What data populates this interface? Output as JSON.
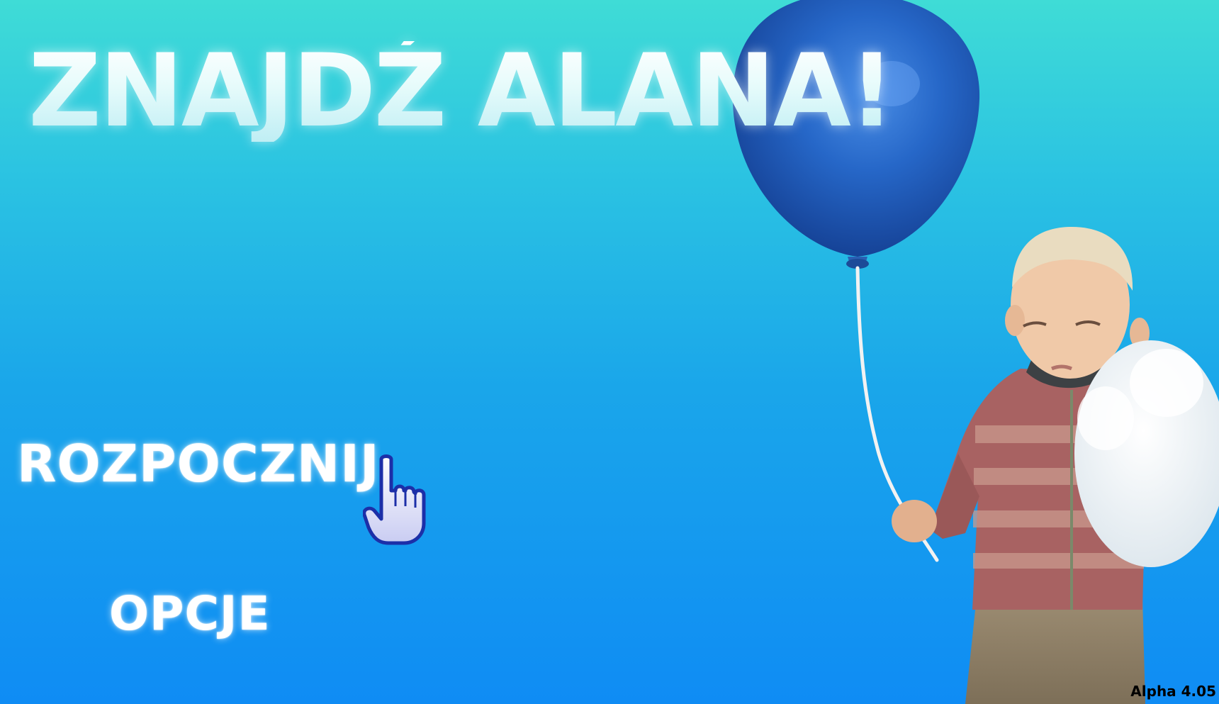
{
  "title": "ZNAJDŹ ALANA!",
  "menu": {
    "start_label": "ROZPOCZNIJ",
    "options_label": "OPCJE"
  },
  "version": "Alpha 4.05",
  "icons": {
    "cursor": "pointing-hand-icon"
  },
  "colors": {
    "background_top": "#3fdcd6",
    "background_bottom": "#0f8cf4",
    "balloon": "#1f5fc0",
    "menu_text": "#ffffff"
  }
}
